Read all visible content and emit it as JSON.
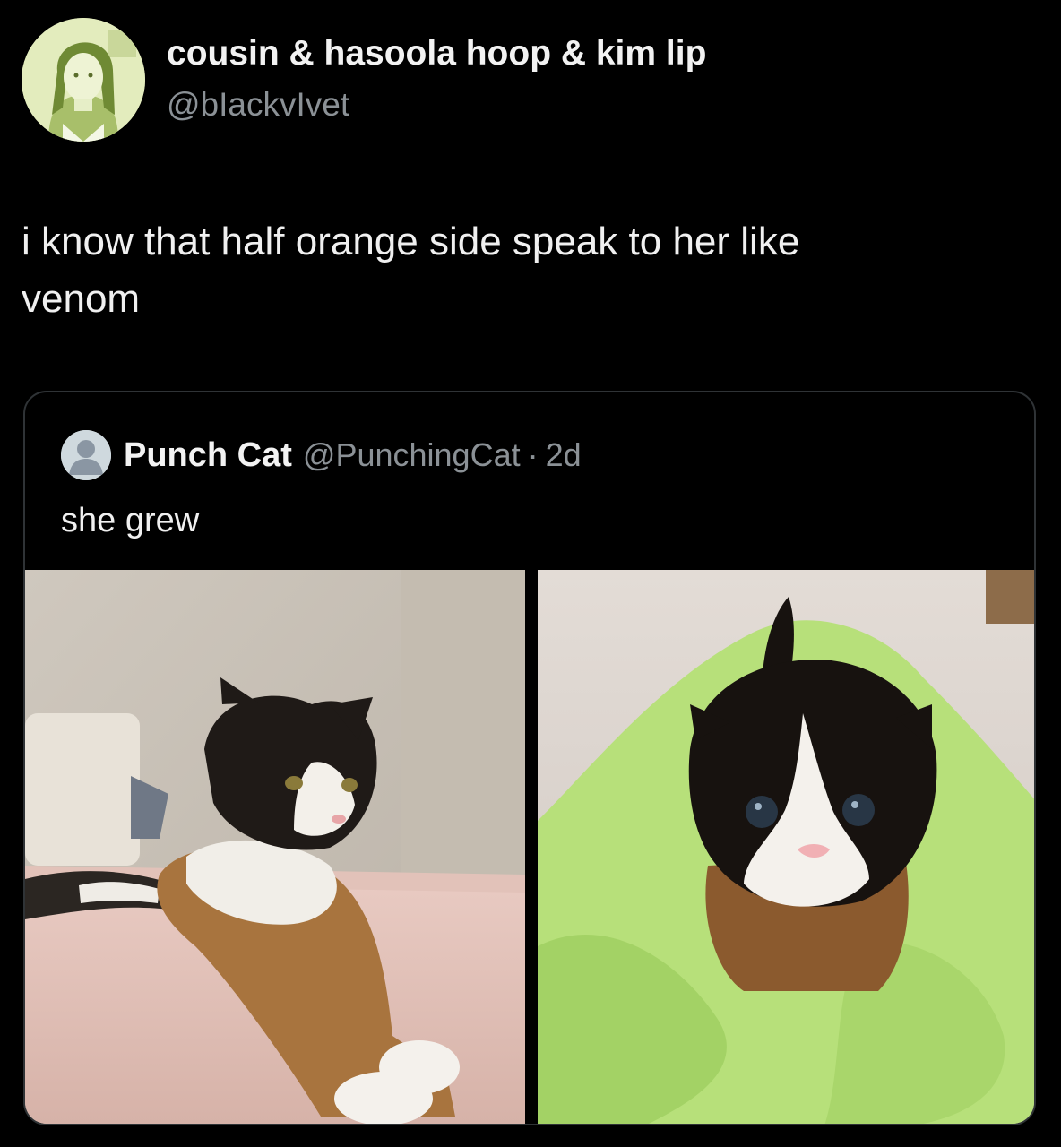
{
  "tweet": {
    "display_name": "cousin & hasoola hoop & kim lip",
    "handle": "@bIackvIvet",
    "text_line1": "i know that half orange side speak to her like",
    "text_line2": "venom",
    "avatar_icon": "profile-photo"
  },
  "quote": {
    "name": "Punch Cat",
    "handle": "@PunchingCat",
    "separator": "·",
    "time": "2d",
    "text": "she grew",
    "avatar_icon": "default-user-icon",
    "images": [
      {
        "icon": "adult-calico-cat-photo"
      },
      {
        "icon": "kitten-in-green-towel-photo"
      }
    ]
  },
  "colors": {
    "background": "#000000",
    "border": "#2f3336",
    "secondary_text": "#8b9196",
    "avatar_tint": "#dfe9b4"
  }
}
